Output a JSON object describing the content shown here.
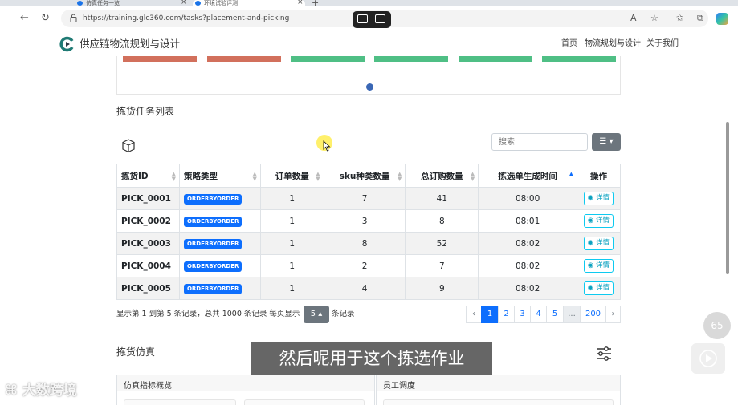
{
  "browser": {
    "tabs": [
      {
        "label": "仿真任务一览",
        "active": false
      },
      {
        "label": "环境试验评测",
        "active": true
      }
    ],
    "url": "https://training.glc360.com/tasks?placement-and-picking"
  },
  "header": {
    "brand": "供应链物流规划与设计",
    "nav": [
      "首页",
      "物流规划与设计",
      "关于我们"
    ]
  },
  "bar_colors": {
    "red": "#d2705c",
    "green": "#4fbf85"
  },
  "picking_section": {
    "title": "拣货任务列表",
    "search_placeholder": "搜索",
    "columns": [
      "拣货ID",
      "策略类型",
      "订单数量",
      "sku种类数量",
      "总订购数量",
      "拣选单生成时间",
      "操作"
    ],
    "rows": [
      {
        "id": "PICK_0001",
        "strategy": "ORDERBYORDER",
        "orders": "1",
        "sku": "7",
        "total": "41",
        "time": "08:00",
        "action": "详情"
      },
      {
        "id": "PICK_0002",
        "strategy": "ORDERBYORDER",
        "orders": "1",
        "sku": "3",
        "total": "8",
        "time": "08:01",
        "action": "详情"
      },
      {
        "id": "PICK_0003",
        "strategy": "ORDERBYORDER",
        "orders": "1",
        "sku": "8",
        "total": "52",
        "time": "08:02",
        "action": "详情"
      },
      {
        "id": "PICK_0004",
        "strategy": "ORDERBYORDER",
        "orders": "1",
        "sku": "2",
        "total": "7",
        "time": "08:02",
        "action": "详情"
      },
      {
        "id": "PICK_0005",
        "strategy": "ORDERBYORDER",
        "orders": "1",
        "sku": "4",
        "total": "9",
        "time": "08:02",
        "action": "详情"
      }
    ],
    "footer_prefix": "显示第 1 到第 5 条记录，总共 1000 条记录  每页显示",
    "per_page": "5",
    "footer_suffix": "条记录",
    "pagination": [
      "‹",
      "1",
      "2",
      "3",
      "4",
      "5",
      "...",
      "200",
      "›"
    ]
  },
  "simulation_section": {
    "title": "拣货仿真",
    "panel_left": "仿真指标概览",
    "panel_right": "员工调度"
  },
  "video_overlay": {
    "subtitle": "然后呢用于这个拣选作业",
    "watermark": "大数跨境",
    "volume": "65"
  }
}
